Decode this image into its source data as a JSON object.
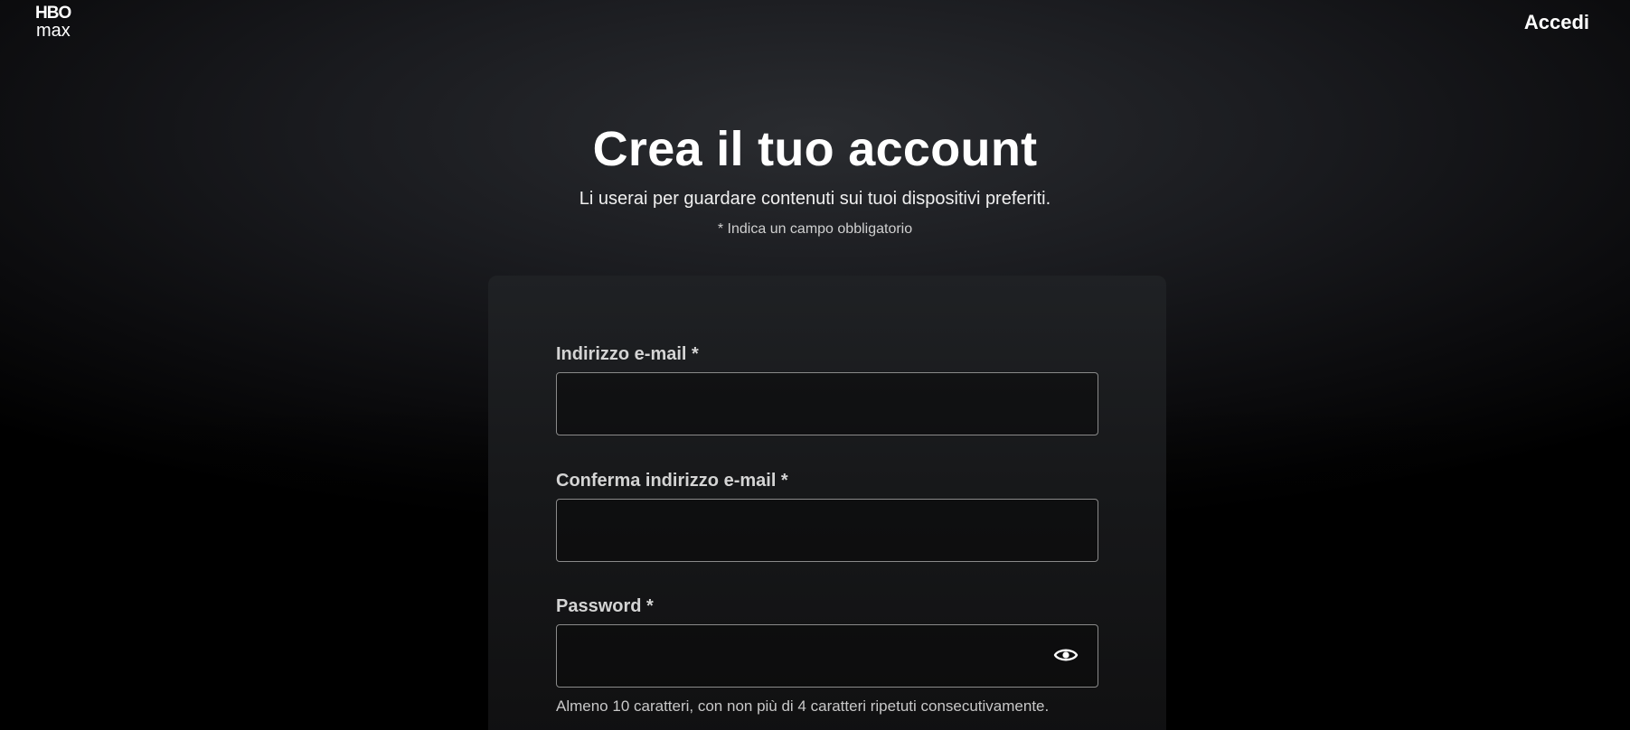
{
  "header": {
    "logo_text_top": "HBO",
    "logo_text_bottom": "max",
    "signin_label": "Accedi"
  },
  "intro": {
    "title": "Crea il tuo account",
    "subtitle": "Li userai per guardare contenuti sui tuoi dispositivi preferiti.",
    "required_note": "* Indica un campo obbligatorio"
  },
  "form": {
    "email": {
      "label": "Indirizzo e-mail *",
      "value": "",
      "placeholder": ""
    },
    "confirm_email": {
      "label": "Conferma indirizzo e-mail *",
      "value": "",
      "placeholder": ""
    },
    "password": {
      "label": "Password *",
      "value": "",
      "placeholder": "",
      "hint": "Almeno 10 caratteri, con non più di 4 caratteri ripetuti consecutivamente.",
      "toggle_icon": "eye-icon"
    }
  },
  "colors": {
    "background": "#000000",
    "card": "#1f2124",
    "input_border": "#8a8a8a",
    "text_primary": "#ffffff",
    "text_secondary": "#d4d4d4"
  }
}
